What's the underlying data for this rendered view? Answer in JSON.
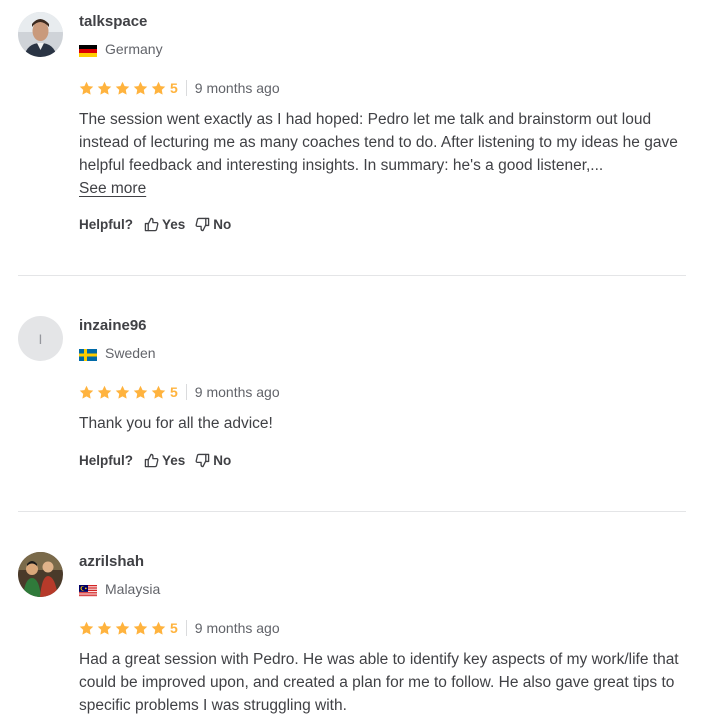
{
  "colors": {
    "star": "#ffb33e",
    "text": "#404145",
    "muted": "#62646a",
    "divider": "#e4e5e7"
  },
  "helpful": {
    "label": "Helpful?",
    "yes": "Yes",
    "no": "No"
  },
  "see_more": "See more",
  "reviews": [
    {
      "username": "talkspace",
      "country": "Germany",
      "rating": "5",
      "date": "9 months ago",
      "text": "The session went exactly as I had hoped: Pedro let me talk and brainstorm out loud instead of lecturing me as many coaches tend to do. After listening to my ideas he gave helpful feedback and interesting insights. In summary: he's a good listener,...",
      "avatar": "photo"
    },
    {
      "username": "inzaine96",
      "country": "Sweden",
      "rating": "5",
      "date": "9 months ago",
      "text": "Thank you for all the advice!",
      "avatar_initial": "I"
    },
    {
      "username": "azrilshah",
      "country": "Malaysia",
      "rating": "5",
      "date": "9 months ago",
      "text": "Had a great session with Pedro. He was able to identify key aspects of my work/life that could be improved upon, and created a plan for me to follow. He also gave great tips to specific problems I was struggling with.",
      "avatar": "photo"
    }
  ]
}
